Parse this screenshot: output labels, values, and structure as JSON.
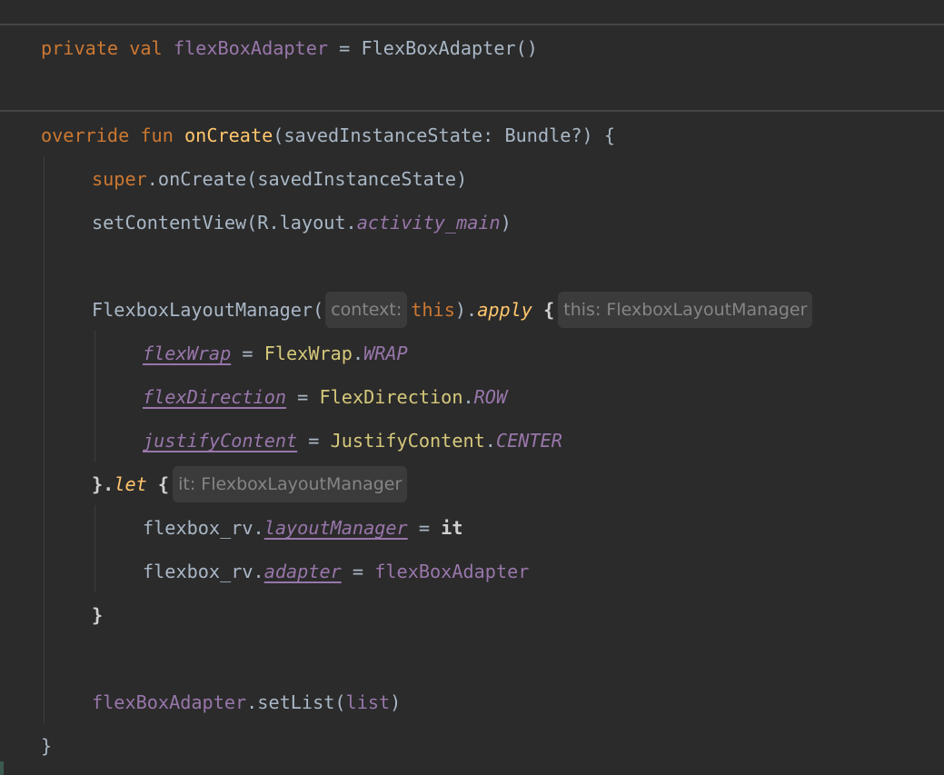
{
  "code": {
    "l1": {
      "kw1": "private",
      "kw2": "val",
      "name": "flexBoxAdapter",
      "op": " = ",
      "call": "FlexBoxAdapter()"
    },
    "l2": {
      "kw1": "override",
      "kw2": "fun",
      "fn": "onCreate",
      "params": "(savedInstanceState: Bundle?) {"
    },
    "l3": {
      "super": "super",
      "rest": ".onCreate(savedInstanceState)"
    },
    "l4": {
      "pre": "setContentView(R.layout.",
      "field": "activity_main",
      "post": ")"
    },
    "l5": {
      "pre": "FlexboxLayoutManager(",
      "hint": "context:",
      "this": "this",
      "mid": ").",
      "apply": "apply",
      "brace": " {",
      "hint2": "this: FlexboxLayoutManager"
    },
    "l6": {
      "prop": "flexWrap",
      "op": " = ",
      "cls": "FlexWrap",
      "dot": ".",
      "val": "WRAP"
    },
    "l7": {
      "prop": "flexDirection",
      "op": " = ",
      "cls": "FlexDirection",
      "dot": ".",
      "val": "ROW"
    },
    "l8": {
      "prop": "justifyContent",
      "op": " = ",
      "cls": "JustifyContent",
      "dot": ".",
      "val": "CENTER"
    },
    "l9": {
      "pre": "}.",
      "let": "let",
      "brace": " {",
      "hint": "it: FlexboxLayoutManager"
    },
    "l10": {
      "pre": "flexbox_rv.",
      "prop": "layoutManager",
      "op": " = ",
      "it": "it"
    },
    "l11": {
      "pre": "flexbox_rv.",
      "prop": "adapter",
      "op": " = ",
      "val": "flexBoxAdapter"
    },
    "l12": {
      "text": "}"
    },
    "l13": {
      "obj": "flexBoxAdapter",
      "call": ".setList(",
      "arg": "list",
      "close": ")"
    },
    "l14": {
      "text": "}"
    }
  }
}
